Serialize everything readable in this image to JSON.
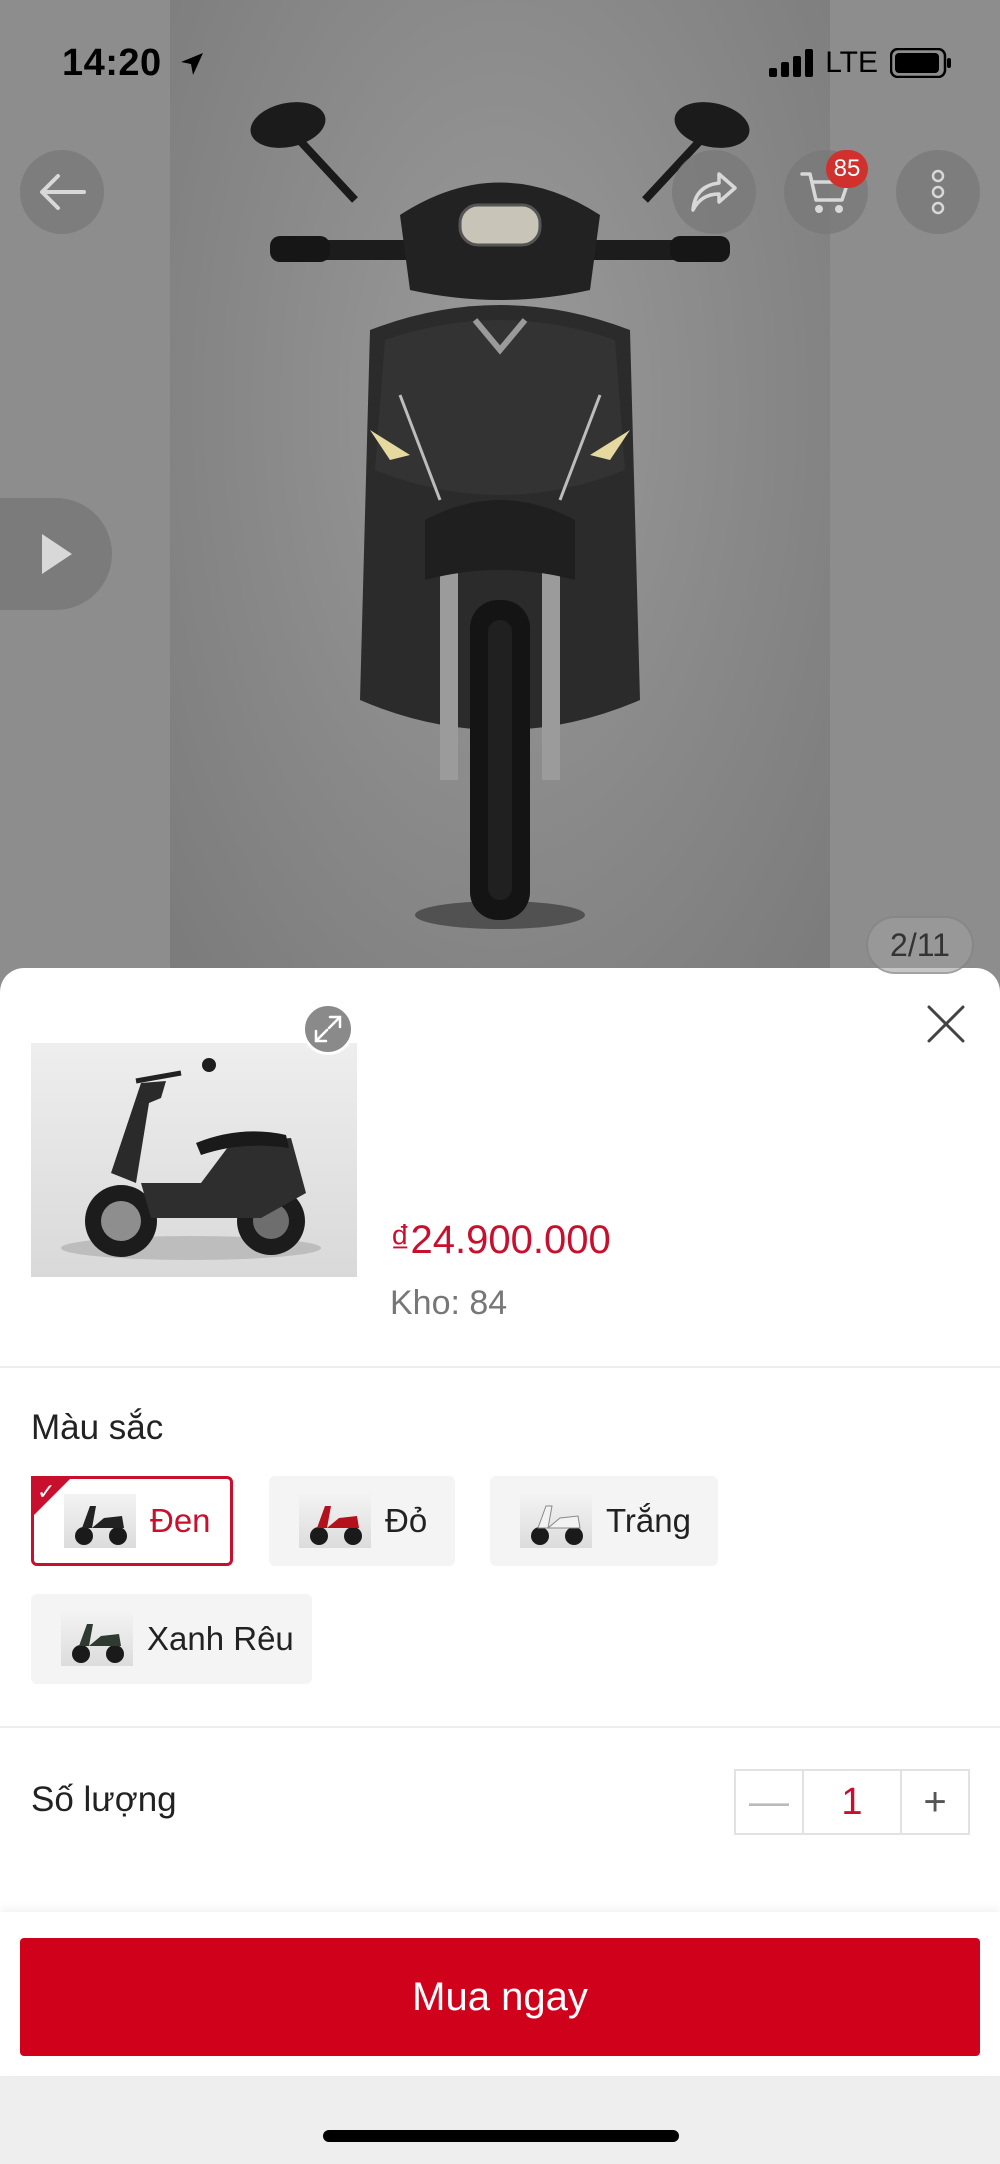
{
  "status_bar": {
    "time": "14:20",
    "network": "LTE"
  },
  "gallery": {
    "counter": "2/11",
    "cart_badge": "85",
    "icons": [
      "back-arrow-icon",
      "share-icon",
      "cart-icon",
      "more-vertical-icon",
      "play-icon"
    ]
  },
  "product": {
    "price": "₫24.900.000",
    "stock": "Kho: 84"
  },
  "color_section": {
    "label": "Màu sắc",
    "options": [
      {
        "label": "Đen",
        "selected": true,
        "swatch": "#222222"
      },
      {
        "label": "Đỏ",
        "selected": false,
        "swatch": "#b3121d"
      },
      {
        "label": "Trắng",
        "selected": false,
        "swatch": "#e8e8e8"
      },
      {
        "label": "Xanh Rêu",
        "selected": false,
        "swatch": "#2f3b30"
      }
    ]
  },
  "quantity_section": {
    "label": "Số lượng",
    "value": "1",
    "minus": "—",
    "plus": "+"
  },
  "buy_button": {
    "label": "Mua ngay"
  },
  "colors": {
    "accent": "#c8102e",
    "button": "#d0021b",
    "badge": "#d0312d"
  }
}
